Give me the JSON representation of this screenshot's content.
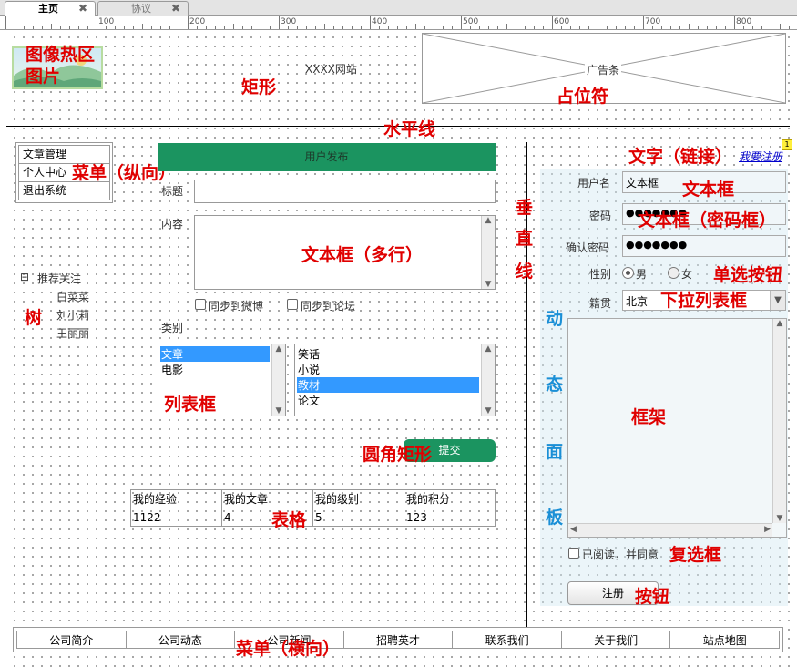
{
  "tabs": [
    {
      "label": "主页",
      "close": "✖"
    },
    {
      "label": "协议",
      "close": "✖"
    }
  ],
  "ruler": {
    "labels": [
      "100",
      "200",
      "300",
      "400",
      "500",
      "600",
      "700",
      "800"
    ]
  },
  "header": {
    "site_name": "XXXX网站",
    "ad_label": "广告条"
  },
  "menu_vertical": {
    "items": [
      "文章管理",
      "个人中心",
      "退出系统"
    ]
  },
  "tree": {
    "root": "推荐关注",
    "toggle": "⊟",
    "children": [
      "白菜菜",
      "刘小莉",
      "王丽丽"
    ]
  },
  "post_form": {
    "header": "用户发布",
    "title_label": "标题",
    "content_label": "内容",
    "sync_weibo": "同步到微博",
    "sync_forum": "同步到论坛",
    "category_label": "类别",
    "list_a": [
      "文章",
      "电影"
    ],
    "list_b": [
      "笑话",
      "小说",
      "教材",
      "论文"
    ],
    "submit": "提交"
  },
  "stats_table": {
    "headers": [
      "我的经验",
      "我的文章",
      "我的级别",
      "我的积分"
    ],
    "values": [
      "1122",
      "4",
      "5",
      "123"
    ]
  },
  "register": {
    "link": "我要注册",
    "badge": "1",
    "username_label": "用户名",
    "username_value": "文本框",
    "password_label": "密码",
    "password_value": "●●●●●●●",
    "confirm_label": "确认密码",
    "confirm_value": "●●●●●●●",
    "gender_label": "性别",
    "male": "男",
    "female": "女",
    "hometown_label": "籍贯",
    "hometown_value": "北京",
    "agree": "已阅读，并同意",
    "button": "注册"
  },
  "menu_horizontal": {
    "items": [
      "公司简介",
      "公司动态",
      "公司新闻",
      "招聘英才",
      "联系我们",
      "关于我们",
      "站点地图"
    ]
  },
  "annotations": {
    "image_hotspot": "图像热区",
    "image": "图片",
    "rect": "矩形",
    "placeholder": "占位符",
    "hline": "水平线",
    "menu_v": "菜单（纵向）",
    "tree": "树",
    "textarea": "文本框（多行）",
    "listbox": "列表框",
    "round_rect": "圆角矩形",
    "table": "表格",
    "menu_h": "菜单（横向）",
    "vline": [
      "垂",
      "直",
      "线"
    ],
    "text_link": "文字（链接）",
    "textbox": "文本框",
    "password": "文本框（密码框）",
    "radio": "单选按钮",
    "dropdown": "下拉列表框",
    "frame": "框架",
    "checkbox": "复选框",
    "button": "按钮",
    "dynamic_panel": [
      "动",
      "态",
      "面",
      "板"
    ]
  }
}
